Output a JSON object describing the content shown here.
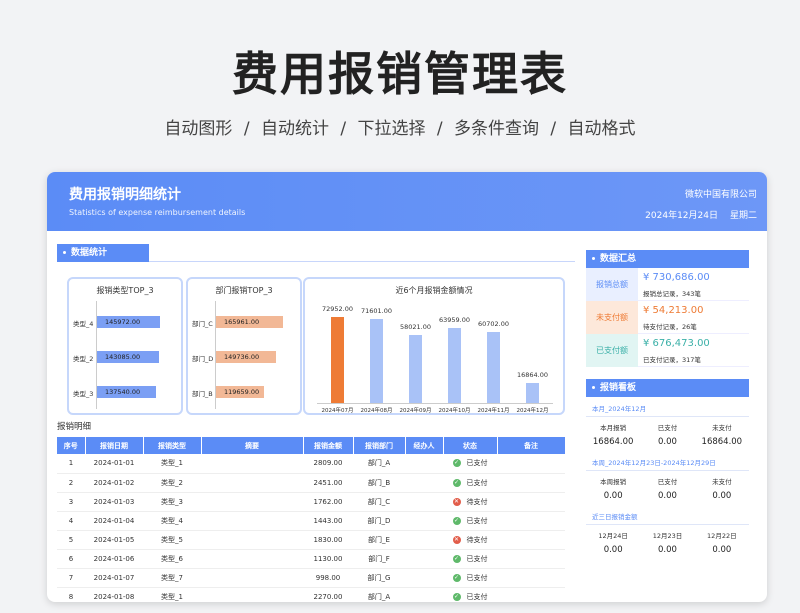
{
  "hero": {
    "title": "费用报销管理表",
    "subtitle": "自动图形  /  自动统计  /  下拉选择   /  多条件查询   /  自动格式"
  },
  "banner": {
    "title": "费用报销明细统计",
    "subtitle": "Statistics of expense reimbursement details",
    "company": "微软中国有限公司",
    "date": "2024年12月24日",
    "weekday": "星期二"
  },
  "stats": {
    "section": "数据统计",
    "type_top": {
      "title": "报销类型TOP_3",
      "rows": [
        {
          "label": "类型_4",
          "value": "145972.00",
          "v": 145972
        },
        {
          "label": "类型_2",
          "value": "143085.00",
          "v": 143085
        },
        {
          "label": "类型_3",
          "value": "137540.00",
          "v": 137540
        }
      ]
    },
    "dept_top": {
      "title": "部门报销TOP_3",
      "rows": [
        {
          "label": "部门_C",
          "value": "165961.00",
          "v": 165961
        },
        {
          "label": "部门_D",
          "value": "149736.00",
          "v": 149736
        },
        {
          "label": "部门_B",
          "value": "119659.00",
          "v": 119659
        }
      ]
    }
  },
  "chart_data": {
    "type": "bar",
    "title": "近6个月报销金额情况",
    "categories": [
      "2024年07月",
      "2024年08月",
      "2024年09月",
      "2024年10月",
      "2024年11月",
      "2024年12月"
    ],
    "values": [
      72952,
      71601,
      58021,
      63959,
      60702,
      16864
    ],
    "labels": [
      "72952.00",
      "71601.00",
      "58021.00",
      "63959.00",
      "60702.00",
      "16864.00"
    ],
    "ylim": [
      0,
      80000
    ],
    "highlight_color": "#ee7b35",
    "bar_color": "#a9c2f7"
  },
  "detail": {
    "title": "报销明细",
    "headers": [
      "序号",
      "报销日期",
      "报销类型",
      "摘要",
      "报销金额",
      "报销部门",
      "经办人",
      "状态",
      "备注"
    ],
    "rows": [
      {
        "no": "1",
        "date": "2024-01-01",
        "type": "类型_1",
        "amount": "2809.00",
        "dept": "部门_A",
        "status": "已支付",
        "paid": true
      },
      {
        "no": "2",
        "date": "2024-01-02",
        "type": "类型_2",
        "amount": "2451.00",
        "dept": "部门_B",
        "status": "已支付",
        "paid": true
      },
      {
        "no": "3",
        "date": "2024-01-03",
        "type": "类型_3",
        "amount": "1762.00",
        "dept": "部门_C",
        "status": "待支付",
        "paid": false
      },
      {
        "no": "4",
        "date": "2024-01-04",
        "type": "类型_4",
        "amount": "1443.00",
        "dept": "部门_D",
        "status": "已支付",
        "paid": true
      },
      {
        "no": "5",
        "date": "2024-01-05",
        "type": "类型_5",
        "amount": "1830.00",
        "dept": "部门_E",
        "status": "待支付",
        "paid": false
      },
      {
        "no": "6",
        "date": "2024-01-06",
        "type": "类型_6",
        "amount": "1130.00",
        "dept": "部门_F",
        "status": "已支付",
        "paid": true
      },
      {
        "no": "7",
        "date": "2024-01-07",
        "type": "类型_7",
        "amount": "998.00",
        "dept": "部门_G",
        "status": "已支付",
        "paid": true
      },
      {
        "no": "8",
        "date": "2024-01-08",
        "type": "类型_1",
        "amount": "2270.00",
        "dept": "部门_A",
        "status": "已支付",
        "paid": true
      }
    ]
  },
  "summary": {
    "title": "数据汇总",
    "items": [
      {
        "label": "报销总额",
        "amount": "¥ 730,686.00",
        "note": "报销总记录，343笔",
        "bg": "#e9efff",
        "color": "#5b8cf6"
      },
      {
        "label": "未支付额",
        "amount": "¥ 54,213.00",
        "note": "待支付记录，26笔",
        "bg": "#fde8da",
        "color": "#ee7b35"
      },
      {
        "label": "已支付额",
        "amount": "¥ 676,473.00",
        "note": "已支付记录，317笔",
        "bg": "#e1f5f3",
        "color": "#3bb0a8"
      }
    ]
  },
  "board": {
    "title": "报销看板",
    "month": {
      "label": "本月_2024年12月",
      "heads": [
        "本月报销",
        "已支付",
        "未支付"
      ],
      "vals": [
        "16864.00",
        "0.00",
        "16864.00"
      ]
    },
    "week": {
      "label": "本周_2024年12月23日-2024年12月29日",
      "heads": [
        "本周报销",
        "已支付",
        "未支付"
      ],
      "vals": [
        "0.00",
        "0.00",
        "0.00"
      ]
    },
    "three": {
      "label": "近三日报销金额",
      "heads": [
        "12月24日",
        "12月23日",
        "12月22日"
      ],
      "vals": [
        "0.00",
        "0.00",
        "0.00"
      ]
    }
  }
}
